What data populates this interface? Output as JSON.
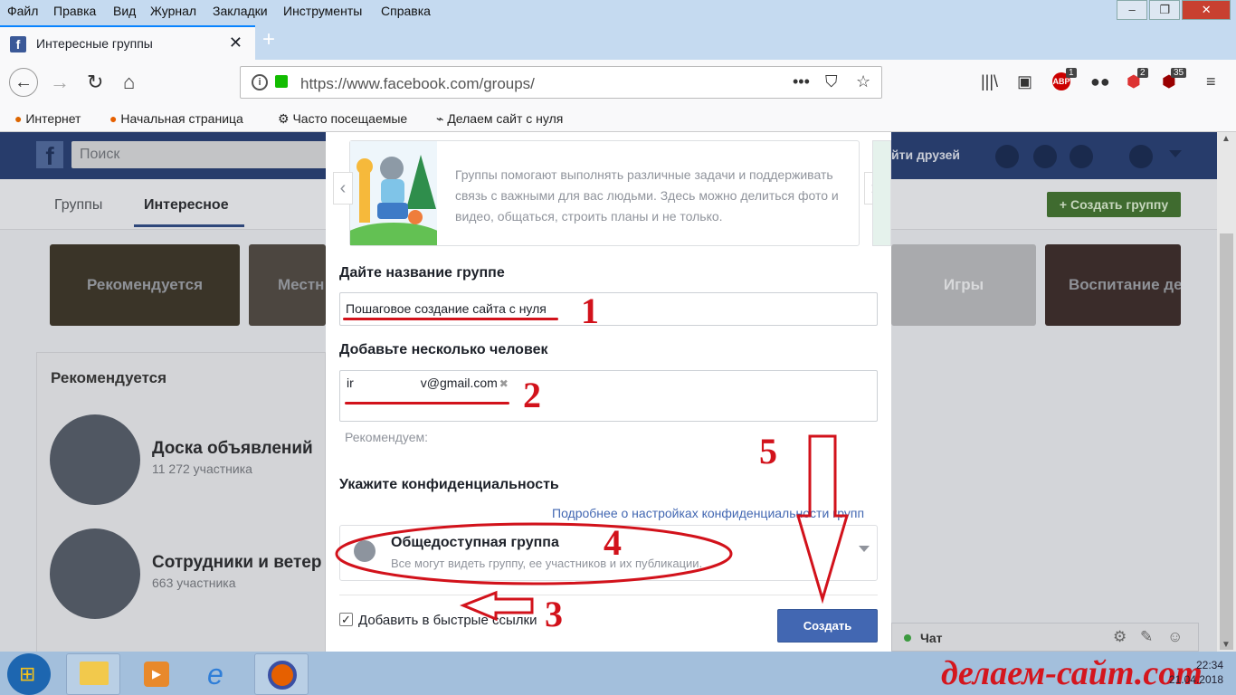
{
  "menubar": {
    "items": [
      "Файл",
      "Правка",
      "Вид",
      "Журнал",
      "Закладки",
      "Инструменты",
      "Справка"
    ]
  },
  "tab": {
    "title": "Интересные группы",
    "close": "✕"
  },
  "urlbar": {
    "url": "https://www.facebook.com/groups/"
  },
  "toolbar_badges": {
    "abp": "1",
    "ext2": "2",
    "ublock": "35"
  },
  "bookmarks": [
    {
      "label": "Интернет",
      "icon": "firefox-icon"
    },
    {
      "label": "Начальная страница",
      "icon": "firefox-icon"
    },
    {
      "label": "Часто посещаемые",
      "icon": "gear-icon"
    },
    {
      "label": "Делаем сайт с нуля",
      "icon": "rss-icon"
    }
  ],
  "facebook": {
    "search_placeholder": "Поиск",
    "find_friends": "йти друзей",
    "tabs": [
      "Группы",
      "Интересное"
    ],
    "create_group": "+ Создать группу",
    "categories": [
      "Рекомендуется",
      "Местн",
      "Игры",
      "Воспитание де"
    ],
    "recommended": {
      "heading": "Рекомендуется",
      "groups": [
        {
          "name": "Доска объявлений",
          "count": "11 272 участника"
        },
        {
          "name": "Сотрудники и ветер",
          "count": "663 участника"
        }
      ]
    },
    "chat": "Чат"
  },
  "modal": {
    "carousel_text": "Группы помогают выполнять различные задачи и поддерживать связь с важными для вас людьми. Здесь можно делиться фото и видео, общаться, строить планы и не только.",
    "name_label": "Дайте название группе",
    "name_value": "Пошаговое создание сайта с нуля",
    "people_label": "Добавьте несколько человек",
    "people_chip_prefix": "ir",
    "people_chip_suffix": "v@gmail.com",
    "recommend": "Рекомендуем:",
    "privacy_label": "Укажите конфиденциальность",
    "privacy_link": "Подробнее о настройках конфиденциальности групп",
    "privacy_title": "Общедоступная группа",
    "privacy_desc": "Все могут видеть группу, ее участников и их публикации.",
    "checkbox_label": "Добавить в быстрые ссылки",
    "checkbox_checked": true,
    "submit": "Создать"
  },
  "annotations": [
    "1",
    "2",
    "3",
    "4",
    "5"
  ],
  "taskbar": {
    "time": "22:34",
    "date": "21.04.2018"
  },
  "watermark": "делаем-сайт.com"
}
